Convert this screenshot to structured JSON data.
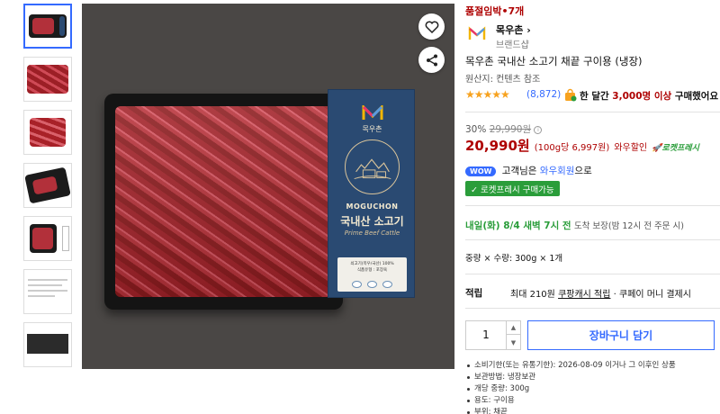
{
  "product": {
    "sold_status": "품절임박•7개",
    "brand_name": "목우촌",
    "brand_shop": "브랜드샵",
    "title": "목우촌 국내산 소고기 채끝 구이용 (냉장)",
    "origin": "원산지: 컨텐츠 참조",
    "stars": "★★★★★",
    "rating": 4.5,
    "review_count": "(8,872)",
    "monthly_buy_prefix": "한 달간",
    "monthly_buy_count": "3,000명 이상",
    "monthly_buy_suffix": "구매했어요"
  },
  "price": {
    "discount_rate": "30%",
    "original_price": "29,990원",
    "info_icon": "i",
    "sale_price": "20,990원",
    "unit_price": "(100g당 6,997원)",
    "wow_discount": "와우할인",
    "rocket_fresh": "로켓프레시"
  },
  "membership": {
    "wow_badge": "WOW",
    "text_prefix": "고객님은",
    "member_label": "와우회원",
    "text_suffix": "으로",
    "fresh_badge": "✓ 로켓프레시 구매가능"
  },
  "delivery": {
    "date": "내일(화) 8/4 새벽 7시 전",
    "guarantee": "도착 보장",
    "note": "(밤 12시 전 주문 시)"
  },
  "option": "중량 × 수량: 300g × 1개",
  "points": {
    "label": "적립",
    "text": "최대 210원",
    "link": "쿠팡캐시 적립",
    "suffix": "· 쿠페이 머니 결제시"
  },
  "cart": {
    "quantity": "1",
    "button": "장바구니 담기"
  },
  "details": [
    "소비기한(또는 유통기한): 2026-08-09 이거나 그 이후인 상품",
    "보관방법: 냉장보관",
    "개당 중량: 300g",
    "용도: 구이용",
    "부위: 채끝"
  ],
  "image_labels": {
    "brand": "목우촌",
    "english_name": "MOGUCHON",
    "korean_name": "국내산 소고기",
    "subtitle": "Prime Beef Cattle",
    "info_line1": "쇠고기(목우/국산) 100%",
    "info_line2": "식품유형 : 포장육"
  },
  "icons": {
    "wishlist": "heart-icon",
    "share": "share-icon"
  },
  "colors": {
    "price_red": "#ae0000",
    "link_blue": "#346aff",
    "fresh_green": "#2a9d3a",
    "star_orange": "#f7a21e"
  }
}
